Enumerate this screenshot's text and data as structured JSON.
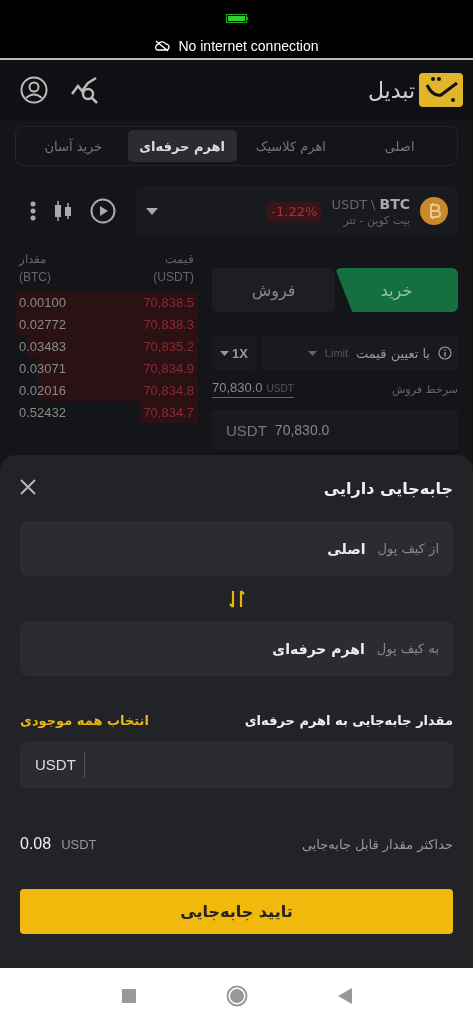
{
  "status_bar": {
    "message": "No internet connection"
  },
  "header": {
    "logo_text": "تبدیل"
  },
  "tabs": [
    {
      "label": "اصلی",
      "selected": false
    },
    {
      "label": "اهرم کلاسیک",
      "selected": false
    },
    {
      "label": "اهرم حرفه‌ای",
      "selected": true
    },
    {
      "label": "خرید آسان",
      "selected": false
    }
  ],
  "pair": {
    "base": "BTC",
    "separator": "\\",
    "quote": "USDT",
    "name": "بیت کوین - تتر",
    "change": "-1.22%"
  },
  "order_book": {
    "columns": [
      {
        "label": "قیمت",
        "unit": "(USDT)"
      },
      {
        "label": "مقدار",
        "unit": "(BTC)"
      }
    ],
    "rows": [
      {
        "price": "70,838.5",
        "amount": "0.00100"
      },
      {
        "price": "70,838.3",
        "amount": "0.02772"
      },
      {
        "price": "70,835.2",
        "amount": "0.03483"
      },
      {
        "price": "70,834.9",
        "amount": "0.03071"
      },
      {
        "price": "70,834.8",
        "amount": "0.02016"
      },
      {
        "price": "70,834.7",
        "amount": "0.52432"
      }
    ]
  },
  "trade": {
    "sides": [
      {
        "label": "خرید",
        "selected": true
      },
      {
        "label": "فروش",
        "selected": false
      }
    ],
    "order_type": {
      "label": "با تعیین قیمت",
      "value": "Limit"
    },
    "leverage": "1X",
    "best_price": {
      "label": "سرخط فروش",
      "value": "70,830.0",
      "unit": "USDT"
    },
    "price_field": {
      "unit": "USDT",
      "value": "70,830.0"
    }
  },
  "transfer_sheet": {
    "title": "جابه‌جایی دارایی",
    "from_wallet": {
      "label": "از کیف پول",
      "value": "اصلی"
    },
    "to_wallet": {
      "label": "به کیف پول",
      "value": "اهرم حرفه‌ای"
    },
    "amount_label": "مقدار جابه‌جایی به اهرم حرفه‌ای",
    "select_all": "انتخاب همه موجودی",
    "amount_field": {
      "unit": "USDT"
    },
    "max": {
      "label": "حداکثر مقدار قابل جابه‌جایی",
      "value": "0.08",
      "unit": "USDT"
    },
    "confirm": "تایید جابه‌جایی"
  }
}
